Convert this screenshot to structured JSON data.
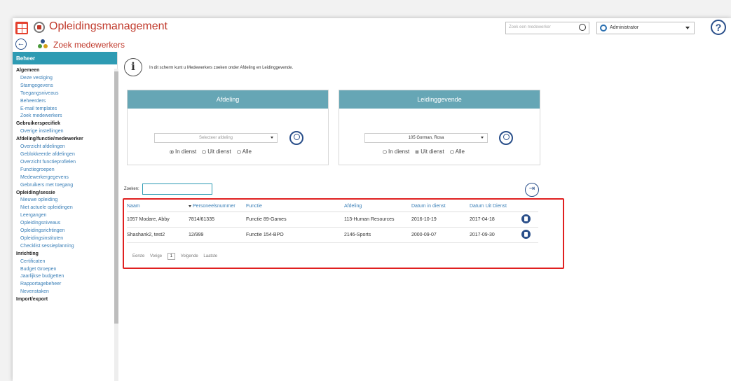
{
  "app": {
    "title": "Opleidingsmanagement",
    "search_placeholder": "Zoek een medewerker",
    "role": "Administrator",
    "help": "?"
  },
  "subbar": {
    "back": "←",
    "title": "Zoek medewerkers"
  },
  "sidebar": {
    "header": "Beheer",
    "sections": [
      {
        "title": "Algemeen",
        "items": [
          "Deze vestiging",
          "Stamgegevens",
          "Toegangsniveaus",
          "Beheerders",
          "E-mail templates",
          "Zoek medewerkers"
        ]
      },
      {
        "title": "Gebruikerspecifiek",
        "items": [
          "Overige instellingen"
        ]
      },
      {
        "title": "Afdeling/functie/medewerker",
        "items": [
          "Overzicht afdelingen",
          "Geblokkeerde afdelingen",
          "Overzicht functieprofielen",
          "Functiegroepen",
          "Medewerkergegevens",
          "Gebruikers met toegang"
        ]
      },
      {
        "title": "Opleiding/sessie",
        "items": [
          "Nieuwe opleiding",
          "Niet actuele opleidingen",
          "Leergangen",
          "Opleidingsniveaus",
          "Opleidingsrichtingen",
          "Opleidingsinstituten",
          "Checklist sessieplanning"
        ]
      },
      {
        "title": "Inrichting",
        "items": [
          "Certificaten",
          "Budget Groepen",
          "Jaarlijkse budgetten",
          "Rapportagebeheer",
          "Nevenstaken"
        ]
      },
      {
        "title": "Import/export",
        "items": []
      }
    ]
  },
  "main": {
    "info_text": "In dit scherm kunt u Medewerkers zoeken onder Afdeling en Leidinggevende.",
    "panel_afdeling": {
      "title": "Afdeling",
      "select_value": "Selecteer afdeling",
      "radios": [
        "In dienst",
        "Uit dienst",
        "Alle"
      ],
      "selected": 0
    },
    "panel_leiding": {
      "title": "Leidinggevende",
      "select_value": "105 Gorman, Rosa",
      "radios": [
        "In dienst",
        "Uit dienst",
        "Alle"
      ],
      "selected": 1
    },
    "zoeken_label": "Zoeken:",
    "zoeken_value": "",
    "table": {
      "headers": [
        "Naam",
        "Personeelsnummer",
        "Functie",
        "Afdeling",
        "Datum in dienst",
        "Datum Uit Dienst"
      ],
      "rows": [
        [
          "1057 Modare, Abby",
          "7814/61335",
          "Functie 89-Games",
          "113-Human Resources",
          "2016-10-19",
          "2017-04-18"
        ],
        [
          "Shashank2, test2",
          "12/999",
          "Functie 154-BPO",
          "2146-Sports",
          "2000-09-07",
          "2017-09-30"
        ]
      ]
    },
    "pager": {
      "first": "Eerste",
      "prev": "Vorige",
      "page": "1",
      "next": "Volgende",
      "last": "Laatste"
    }
  },
  "colors": {
    "accent": "#c0392b",
    "teal": "#2e9bb3",
    "panel_head": "#66a6b5",
    "highlight": "#e02020",
    "link": "#3a7fb7"
  }
}
